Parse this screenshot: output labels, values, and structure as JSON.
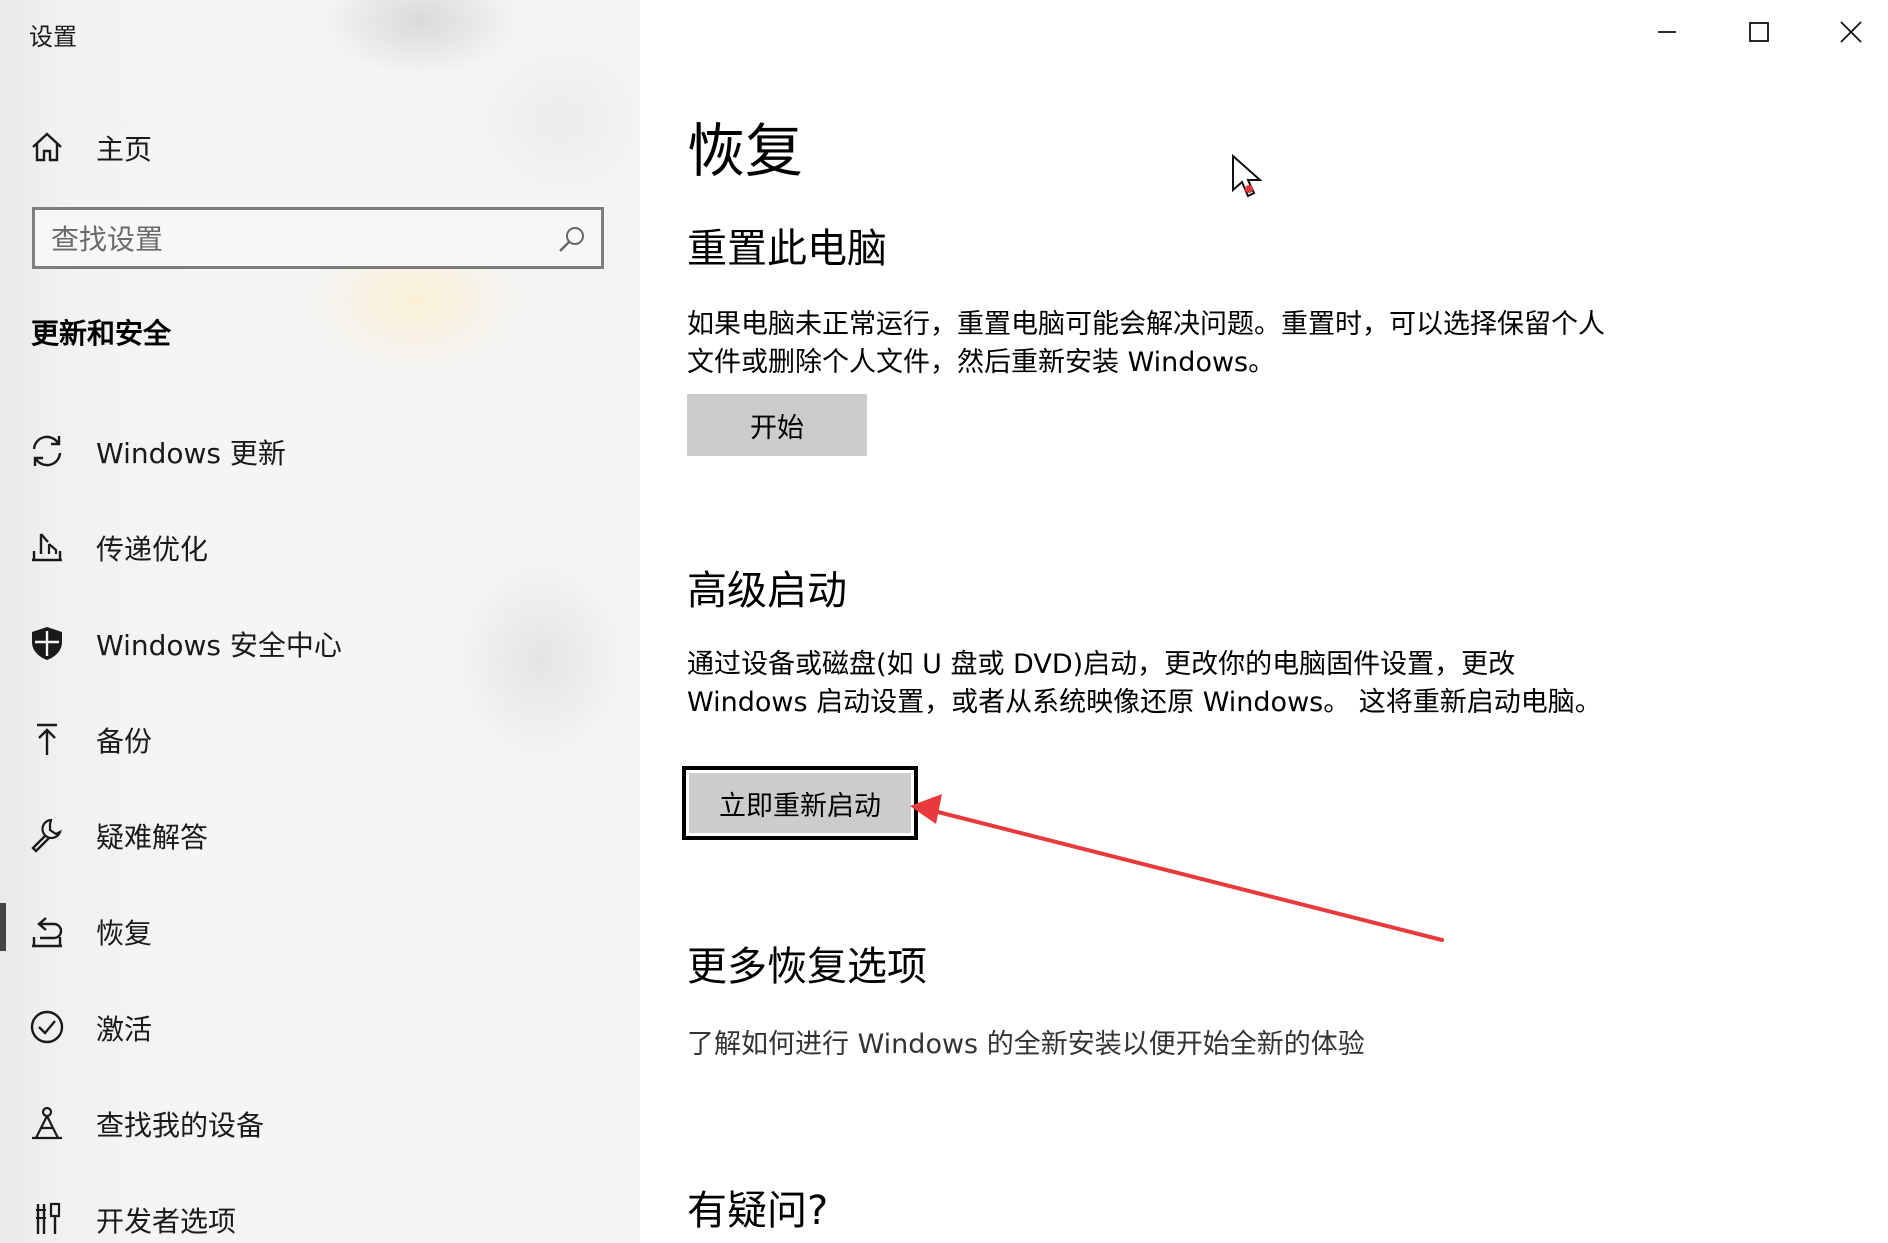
{
  "window": {
    "title": "设置",
    "minimize_icon": "minimize-icon",
    "maximize_icon": "maximize-icon",
    "close_icon": "close-icon"
  },
  "sidebar": {
    "home": {
      "label": "主页",
      "icon": "home-icon"
    },
    "search": {
      "placeholder": "查找设置",
      "icon": "search-icon"
    },
    "section_heading": "更新和安全",
    "items": [
      {
        "label": "Windows 更新",
        "icon": "sync-icon"
      },
      {
        "label": "传递优化",
        "icon": "delivery-optimization-icon"
      },
      {
        "label": "Windows 安全中心",
        "icon": "shield-icon"
      },
      {
        "label": "备份",
        "icon": "upload-arrow-icon"
      },
      {
        "label": "疑难解答",
        "icon": "wrench-icon"
      },
      {
        "label": "恢复",
        "icon": "recovery-icon",
        "selected": true
      },
      {
        "label": "激活",
        "icon": "check-circle-icon"
      },
      {
        "label": "查找我的设备",
        "icon": "find-device-icon"
      },
      {
        "label": "开发者选项",
        "icon": "developer-tools-icon"
      }
    ]
  },
  "main": {
    "title": "恢复",
    "reset": {
      "heading": "重置此电脑",
      "description": "如果电脑未正常运行，重置电脑可能会解决问题。重置时，可以选择保留个人文件或删除个人文件，然后重新安装 Windows。",
      "button_label": "开始"
    },
    "advanced_startup": {
      "heading": "高级启动",
      "description": "通过设备或磁盘(如 U 盘或 DVD)启动，更改你的电脑固件设置，更改 Windows 启动设置，或者从系统映像还原 Windows。 这将重新启动电脑。",
      "button_label": "立即重新启动"
    },
    "more_options": {
      "heading": "更多恢复选项",
      "link_text": "了解如何进行 Windows 的全新安装以便开始全新的体验"
    },
    "questions": {
      "heading": "有疑问?"
    }
  },
  "annotation": {
    "color": "#e8393d",
    "type": "arrow"
  }
}
